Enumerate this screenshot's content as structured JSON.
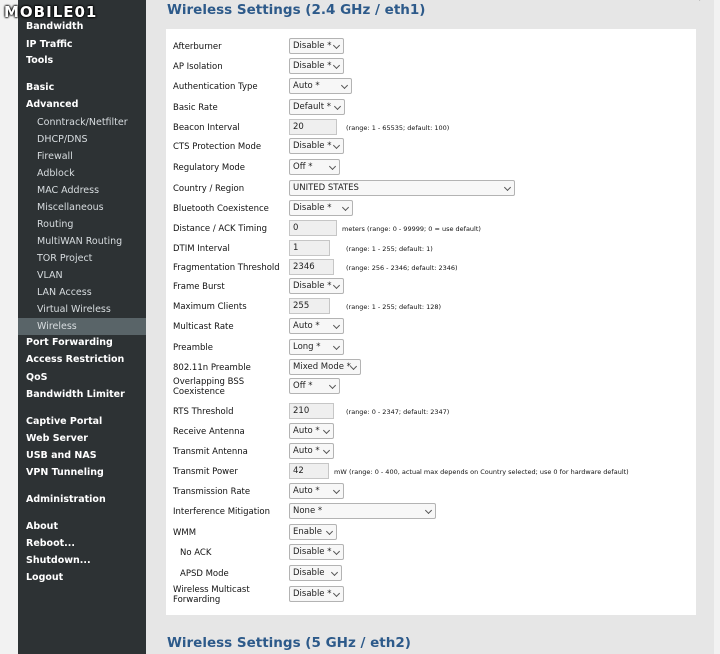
{
  "watermark": "MOBILE01",
  "sidebar": {
    "items": [
      {
        "label": "Bandwidth",
        "type": "bold"
      },
      {
        "label": "IP Traffic",
        "type": "bold"
      },
      {
        "label": "Tools",
        "type": "bold"
      },
      {
        "label": "Basic",
        "type": "bold"
      },
      {
        "label": "Advanced",
        "type": "bold"
      },
      {
        "label": "Conntrack/Netfilter",
        "type": "sub"
      },
      {
        "label": "DHCP/DNS",
        "type": "sub"
      },
      {
        "label": "Firewall",
        "type": "sub"
      },
      {
        "label": "Adblock",
        "type": "sub"
      },
      {
        "label": "MAC Address",
        "type": "sub"
      },
      {
        "label": "Miscellaneous",
        "type": "sub"
      },
      {
        "label": "Routing",
        "type": "sub"
      },
      {
        "label": "MultiWAN Routing",
        "type": "sub"
      },
      {
        "label": "TOR Project",
        "type": "sub"
      },
      {
        "label": "VLAN",
        "type": "sub"
      },
      {
        "label": "LAN Access",
        "type": "sub"
      },
      {
        "label": "Virtual Wireless",
        "type": "sub"
      },
      {
        "label": "Wireless",
        "type": "sub-active"
      },
      {
        "label": "Port Forwarding",
        "type": "bold"
      },
      {
        "label": "Access Restriction",
        "type": "bold"
      },
      {
        "label": "QoS",
        "type": "bold"
      },
      {
        "label": "Bandwidth Limiter",
        "type": "bold"
      },
      {
        "label": "Captive Portal",
        "type": "bold"
      },
      {
        "label": "Web Server",
        "type": "bold"
      },
      {
        "label": "USB and NAS",
        "type": "bold"
      },
      {
        "label": "VPN Tunneling",
        "type": "bold"
      },
      {
        "label": "Administration",
        "type": "bold"
      },
      {
        "label": "About",
        "type": "bold"
      },
      {
        "label": "Reboot...",
        "type": "bold"
      },
      {
        "label": "Shutdown...",
        "type": "bold"
      },
      {
        "label": "Logout",
        "type": "bold"
      }
    ]
  },
  "main": {
    "title_24": "Wireless Settings (2.4 GHz / eth1)",
    "title_5": "Wireless Settings (5 GHz / eth2)",
    "rows": [
      {
        "label": "Afterburner",
        "kind": "select",
        "value": "Disable *"
      },
      {
        "label": "AP Isolation",
        "kind": "select",
        "value": "Disable *"
      },
      {
        "label": "Authentication Type",
        "kind": "select",
        "value": "Auto *"
      },
      {
        "label": "Basic Rate",
        "kind": "select",
        "value": "Default *"
      },
      {
        "label": "Beacon Interval",
        "kind": "input",
        "value": "20",
        "hint": "(range: 1 - 65535; default: 100)"
      },
      {
        "label": "CTS Protection Mode",
        "kind": "select",
        "value": "Disable *"
      },
      {
        "label": "Regulatory Mode",
        "kind": "select",
        "value": "Off *"
      },
      {
        "label": "Country / Region",
        "kind": "select",
        "value": "UNITED STATES"
      },
      {
        "label": "Bluetooth Coexistence",
        "kind": "select",
        "value": "Disable *"
      },
      {
        "label": "Distance / ACK Timing",
        "kind": "input",
        "value": "0",
        "unit": "meters",
        "hint": "(range: 0 - 99999; 0 = use default)"
      },
      {
        "label": "DTIM Interval",
        "kind": "input",
        "value": "1",
        "hint": "(range: 1 - 255; default: 1)"
      },
      {
        "label": "Fragmentation Threshold",
        "kind": "input",
        "value": "2346",
        "hint": "(range: 256 - 2346; default: 2346)"
      },
      {
        "label": "Frame Burst",
        "kind": "select",
        "value": "Disable *"
      },
      {
        "label": "Maximum Clients",
        "kind": "input",
        "value": "255",
        "hint": "(range: 1 - 255; default: 128)"
      },
      {
        "label": "Multicast Rate",
        "kind": "select",
        "value": "Auto *"
      },
      {
        "label": "Preamble",
        "kind": "select",
        "value": "Long *"
      },
      {
        "label": "802.11n Preamble",
        "kind": "select",
        "value": "Mixed Mode *"
      },
      {
        "label_lines": [
          "Overlapping BSS",
          "Coexistence"
        ],
        "kind": "select",
        "value": "Off *"
      },
      {
        "label": "RTS Threshold",
        "kind": "input",
        "value": "210",
        "hint": "(range: 0 - 2347; default: 2347)"
      },
      {
        "label": "Receive Antenna",
        "kind": "select",
        "value": "Auto *"
      },
      {
        "label": "Transmit Antenna",
        "kind": "select",
        "value": "Auto *"
      },
      {
        "label": "Transmit Power",
        "kind": "input",
        "value": "42",
        "unit": "mW",
        "hint": "(range: 0 - 400, actual max depends on Country selected; use 0 for hardware default)"
      },
      {
        "label": "Transmission Rate",
        "kind": "select",
        "value": "Auto *"
      },
      {
        "label": "Interference Mitigation",
        "kind": "select",
        "value": "None *"
      },
      {
        "label": "WMM",
        "kind": "select",
        "value": "Enable"
      },
      {
        "label": "No ACK",
        "kind": "select",
        "value": "Disable *"
      },
      {
        "label": "APSD Mode",
        "kind": "select",
        "value": "Disable"
      },
      {
        "label_lines": [
          "Wireless Multicast",
          "Forwarding"
        ],
        "kind": "select",
        "value": "Disable *"
      }
    ]
  }
}
